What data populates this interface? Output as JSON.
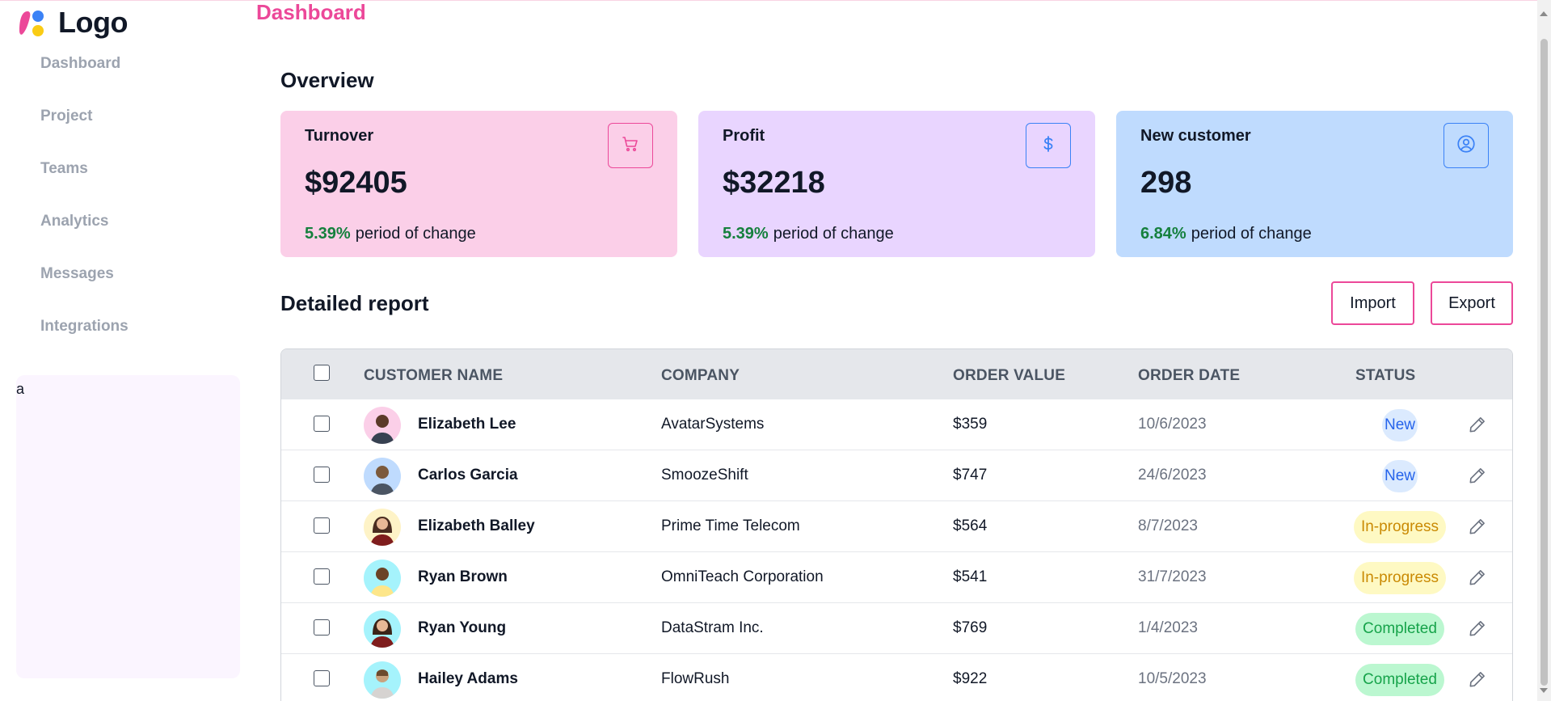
{
  "brand": {
    "logo_text": "Logo"
  },
  "sidebar": {
    "items": [
      {
        "label": "Dashboard"
      },
      {
        "label": "Project"
      },
      {
        "label": "Teams"
      },
      {
        "label": "Analytics"
      },
      {
        "label": "Messages"
      },
      {
        "label": "Integrations"
      }
    ],
    "panel_text": "a"
  },
  "header": {
    "title": "Dashboard"
  },
  "overview": {
    "title": "Overview",
    "cards": [
      {
        "label": "Turnover",
        "value": "$92405",
        "change_pct": "5.39%",
        "change_text": "period of change",
        "icon": "cart-icon",
        "bg": "#fbcfe8",
        "accent": "#ec4899"
      },
      {
        "label": "Profit",
        "value": "$32218",
        "change_pct": "5.39%",
        "change_text": "period of change",
        "icon": "dollar-icon",
        "bg": "#e9d5ff",
        "accent": "#3b82f6"
      },
      {
        "label": "New customer",
        "value": "298",
        "change_pct": "6.84%",
        "change_text": "period of change",
        "icon": "user-circle-icon",
        "bg": "#bfdbfe",
        "accent": "#3b82f6"
      }
    ]
  },
  "report": {
    "title": "Detailed report",
    "import_label": "Import",
    "export_label": "Export",
    "columns": {
      "customer_name": "CUSTOMER NAME",
      "company": "COMPANY",
      "order_value": "ORDER VALUE",
      "order_date": "ORDER DATE",
      "status": "STATUS"
    },
    "rows": [
      {
        "name": "Elizabeth Lee",
        "company": "AvatarSystems",
        "value": "$359",
        "date": "10/6/2023",
        "status": "New",
        "avatar_bg": "#fbcfe8"
      },
      {
        "name": "Carlos Garcia",
        "company": "SmoozeShift",
        "value": "$747",
        "date": "24/6/2023",
        "status": "New",
        "avatar_bg": "#bfdbfe"
      },
      {
        "name": "Elizabeth Balley",
        "company": "Prime Time Telecom",
        "value": "$564",
        "date": "8/7/2023",
        "status": "In-progress",
        "avatar_bg": "#fef3c7"
      },
      {
        "name": "Ryan Brown",
        "company": "OmniTeach Corporation",
        "value": "$541",
        "date": "31/7/2023",
        "status": "In-progress",
        "avatar_bg": "#a5f3fc"
      },
      {
        "name": "Ryan Young",
        "company": "DataStram Inc.",
        "value": "$769",
        "date": "1/4/2023",
        "status": "Completed",
        "avatar_bg": "#a5f3fc"
      },
      {
        "name": "Hailey Adams",
        "company": "FlowRush",
        "value": "$922",
        "date": "10/5/2023",
        "status": "Completed",
        "avatar_bg": "#a5f3fc"
      }
    ],
    "status_colors": {
      "New": {
        "bg": "#dbeafe",
        "fg": "#2563eb"
      },
      "In-progress": {
        "bg": "#fef9c3",
        "fg": "#ca8a04"
      },
      "Completed": {
        "bg": "#bbf7d0",
        "fg": "#16a34a"
      }
    }
  }
}
